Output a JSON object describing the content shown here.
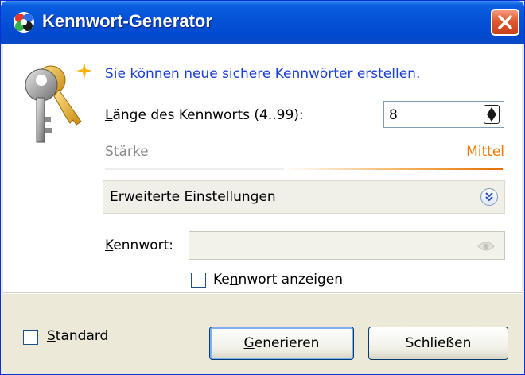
{
  "window": {
    "title": "Kennwort-Generator",
    "app_icon": "app-icon",
    "close_icon": "close-icon"
  },
  "intro": {
    "text": "Sie können neue sichere Kennwörter erstellen.",
    "icon": "keys-icon"
  },
  "length": {
    "label_prefix": "L",
    "label_rest": "änge des Kennworts (4..99):",
    "value": "8"
  },
  "strength": {
    "label": "Stärke",
    "value_label": "Mittel",
    "level": 0.55,
    "color": "#f07a00"
  },
  "advanced": {
    "label": "Erweiterte Einstellungen",
    "toggle_icon": "chevron-down-circle-icon"
  },
  "password": {
    "label_prefix": "K",
    "label_rest": "ennwort:",
    "value": "",
    "show_label_a": "Ke",
    "show_label_u": "n",
    "show_label_b": "nwort anzeigen",
    "show_checked": false
  },
  "footer": {
    "standard_u": "S",
    "standard_rest": "tandard",
    "standard_checked": false,
    "generate_u": "G",
    "generate_rest": "enerieren",
    "close_label": "Schließen"
  },
  "colors": {
    "titlebar": "#0552d6",
    "accent_text": "#1a3fd6",
    "strength": "#f07a00"
  }
}
